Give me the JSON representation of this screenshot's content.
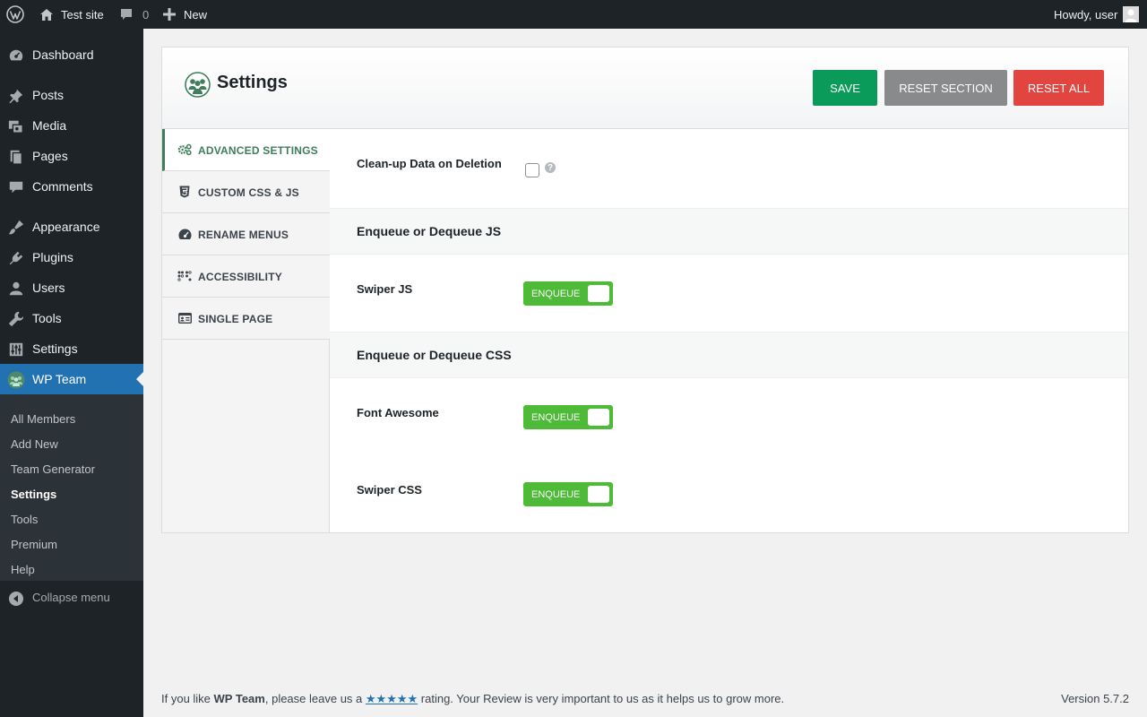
{
  "adminbar": {
    "site_name": "Test site",
    "comments_count": "0",
    "new_label": "New",
    "howdy": "Howdy, user"
  },
  "sidebar": {
    "items": [
      {
        "label": "Dashboard",
        "icon": "dashboard-icon"
      },
      {
        "label": "Posts",
        "icon": "pin-icon"
      },
      {
        "label": "Media",
        "icon": "media-icon"
      },
      {
        "label": "Pages",
        "icon": "pages-icon"
      },
      {
        "label": "Comments",
        "icon": "comment-icon"
      },
      {
        "label": "Appearance",
        "icon": "brush-icon"
      },
      {
        "label": "Plugins",
        "icon": "plug-icon"
      },
      {
        "label": "Users",
        "icon": "user-icon"
      },
      {
        "label": "Tools",
        "icon": "wrench-icon"
      },
      {
        "label": "Settings",
        "icon": "sliders-icon"
      },
      {
        "label": "WP Team",
        "icon": "team-icon"
      }
    ],
    "submenu": [
      "All Members",
      "Add New",
      "Team Generator",
      "Settings",
      "Tools",
      "Premium",
      "Help"
    ],
    "submenu_active": "Settings",
    "collapse_label": "Collapse menu"
  },
  "settings": {
    "title": "Settings",
    "buttons": {
      "save": "SAVE",
      "reset_section": "RESET SECTION",
      "reset_all": "RESET ALL"
    },
    "tabs": [
      {
        "label": "ADVANCED SETTINGS",
        "icon": "gears-icon",
        "active": true
      },
      {
        "label": "CUSTOM CSS & JS",
        "icon": "css3-icon"
      },
      {
        "label": "RENAME MENUS",
        "icon": "gauge-icon"
      },
      {
        "label": "ACCESSIBILITY",
        "icon": "braille-icon"
      },
      {
        "label": "SINGLE PAGE",
        "icon": "id-card-icon"
      }
    ],
    "fields": {
      "cleanup_label": "Clean-up Data on Deletion",
      "cleanup_checked": false,
      "js_section": "Enqueue or Dequeue JS",
      "swiper_js_label": "Swiper JS",
      "css_section": "Enqueue or Dequeue CSS",
      "font_awesome_label": "Font Awesome",
      "swiper_css_label": "Swiper CSS",
      "toggle_text": "ENQUEUE"
    },
    "colors": {
      "save": "#0a9b5a",
      "reset_section": "#888a8c",
      "reset_all": "#e2453f",
      "toggle_on": "#4dbb37",
      "active_tab": "#3f7d5b"
    }
  },
  "footer": {
    "prefix": "If you like ",
    "plugin_name": "WP Team",
    "middle": ", please leave us a ",
    "stars": "★★★★★",
    "suffix": " rating. Your Review is very important to us as it helps us to grow more.",
    "version": "Version 5.7.2"
  }
}
